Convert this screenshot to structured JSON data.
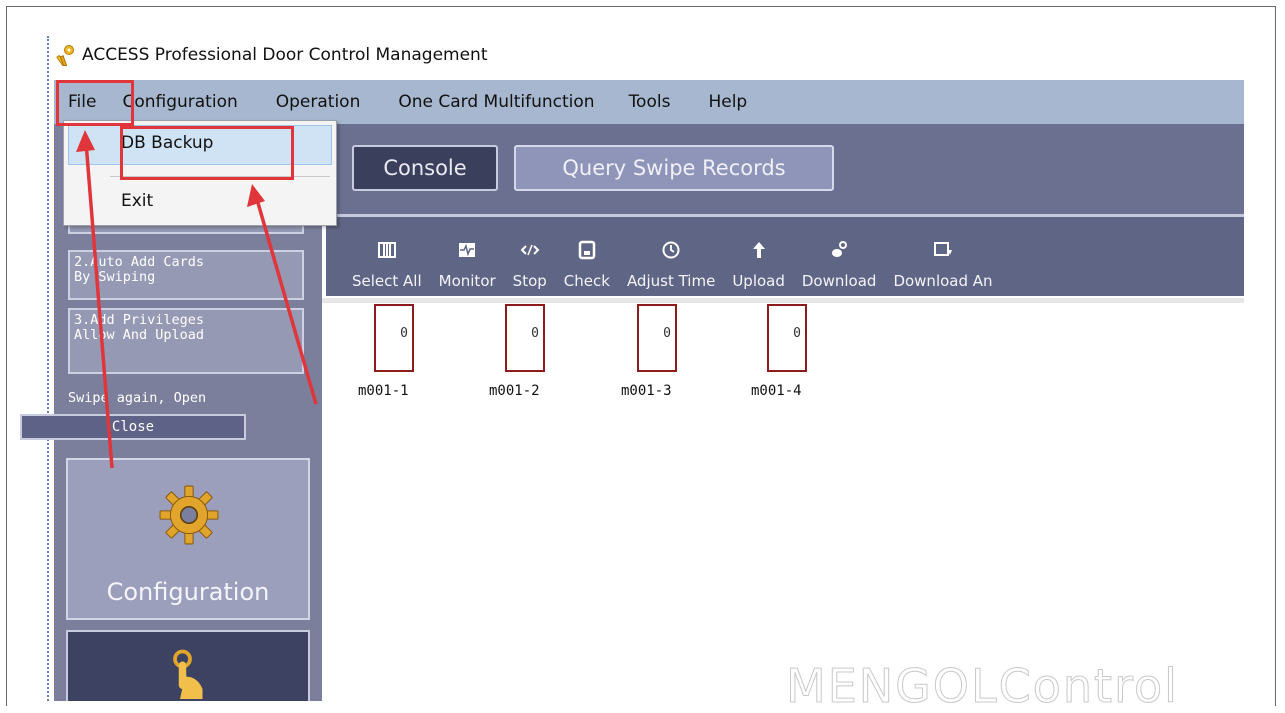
{
  "window": {
    "title": "ACCESS Professional Door Control Management",
    "app_icon": "keys-icon"
  },
  "menubar": {
    "items": [
      {
        "label": "File"
      },
      {
        "label": "Configuration"
      },
      {
        "label": "Operation"
      },
      {
        "label": "One Card Multifunction"
      },
      {
        "label": "Tools"
      },
      {
        "label": "Help"
      }
    ]
  },
  "file_menu": {
    "items": [
      {
        "label": "DB Backup",
        "highlighted": true
      },
      {
        "label": "Exit"
      }
    ]
  },
  "tabs": [
    {
      "label": "Console",
      "active": true
    },
    {
      "label": "Query Swipe Records",
      "active": false
    }
  ],
  "toolbar": {
    "items": [
      {
        "label": "Select All",
        "icon": "select-all-icon"
      },
      {
        "label": "Monitor",
        "icon": "monitor-icon"
      },
      {
        "label": "Stop",
        "icon": "stop-icon"
      },
      {
        "label": "Check",
        "icon": "check-icon"
      },
      {
        "label": "Adjust Time",
        "icon": "clock-icon"
      },
      {
        "label": "Upload",
        "icon": "upload-icon"
      },
      {
        "label": "Download",
        "icon": "download-icon"
      },
      {
        "label": "Download An",
        "icon": "download-and-icon"
      }
    ]
  },
  "sidebar": {
    "step2": {
      "line1": "2.Auto Add Cards",
      "line2": "By Swiping"
    },
    "step3": {
      "line1": "3.Add Privileges",
      "line2": "Allow And Upload"
    },
    "swipe_text": "Swipe again, Open",
    "close_label": "Close",
    "config_label": "Configuration"
  },
  "doors": [
    {
      "name": "m001-1",
      "value": "0"
    },
    {
      "name": "m001-2",
      "value": "0"
    },
    {
      "name": "m001-3",
      "value": "0"
    },
    {
      "name": "m001-4",
      "value": "0"
    }
  ],
  "watermark": "MENGOLControl",
  "colors": {
    "annotation_red": "#e0353a",
    "menubar": "#a7b7cf",
    "toolbar": "#5f6584",
    "door_border": "#8d1b1b"
  }
}
